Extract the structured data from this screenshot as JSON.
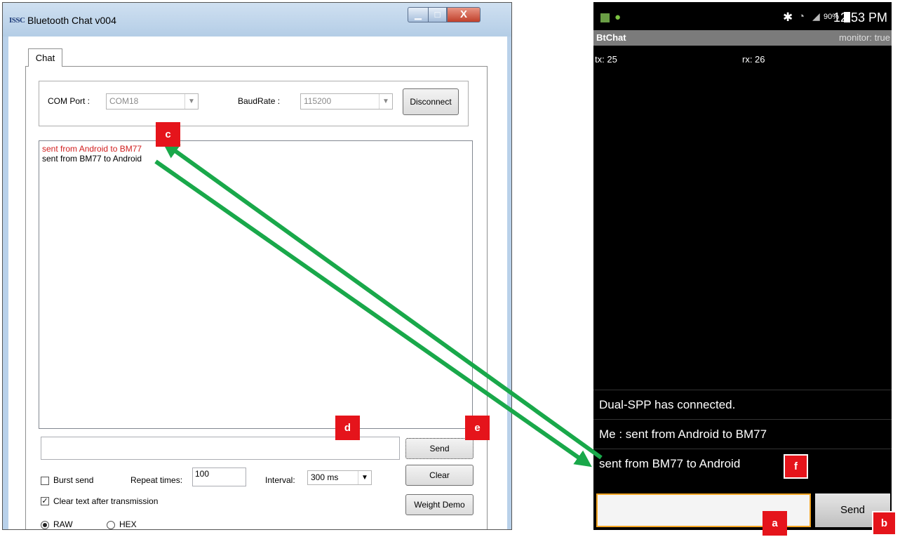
{
  "windows_app": {
    "icon_text": "ISSC",
    "title": "Bluetooth Chat v004",
    "window_buttons": {
      "minimize": "▁",
      "maximize": "□",
      "close": "X"
    },
    "tab_label": "Chat",
    "com_port_label": "COM Port :",
    "com_port_value": "COM18",
    "baud_rate_label": "BaudRate :",
    "baud_rate_value": "115200",
    "disconnect_label": "Disconnect",
    "log_lines": [
      {
        "text": "sent from Android to BM77",
        "color": "#d11f1f"
      },
      {
        "text": "sent from BM77 to Android",
        "color": "#000000"
      }
    ],
    "message_input_value": "",
    "send_label": "Send",
    "clear_label": "Clear",
    "weight_demo_label": "Weight Demo",
    "burst_send_label": "Burst send",
    "burst_send_checked": false,
    "repeat_times_label": "Repeat times:",
    "repeat_times_value": "100",
    "interval_label": "Interval:",
    "interval_value": "300 ms",
    "clear_text_label": "Clear text after transmission",
    "clear_text_checked": true,
    "mode_raw_label": "RAW",
    "mode_hex_label": "HEX",
    "mode_selected": "RAW"
  },
  "phone": {
    "status_bar": {
      "battery": "90%",
      "time": "12:53 PM"
    },
    "app_title": "BtChat",
    "monitor": "monitor: true",
    "tx": "tx: 25",
    "rx": "rx: 26",
    "messages": [
      "Dual-SPP has connected.",
      "Me : sent from Android to BM77",
      "sent from BM77 to Android"
    ],
    "input_value": "",
    "send_label": "Send"
  },
  "callouts": {
    "a": "a",
    "b": "b",
    "c": "c",
    "d": "d",
    "e": "e",
    "f": "f"
  },
  "colors": {
    "callout": "#e5141b",
    "arrow": "#19a84a",
    "phone_input_border": "#f5a623",
    "sent_text": "#d11f1f"
  }
}
